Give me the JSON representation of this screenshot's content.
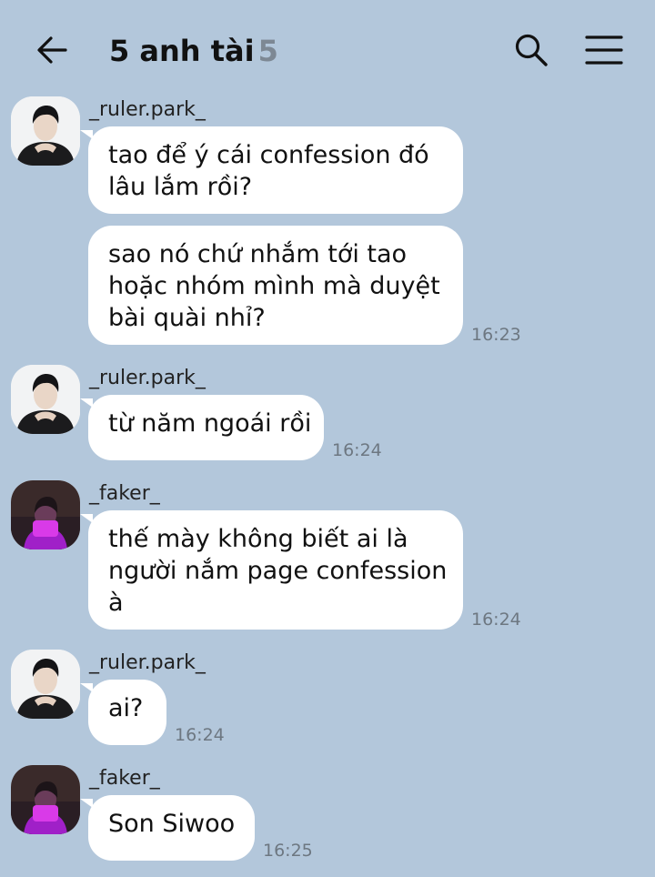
{
  "header": {
    "title": "5 anh tài",
    "member_count": "5",
    "back_icon": "arrow-left-icon",
    "search_icon": "search-icon",
    "menu_icon": "hamburger-menu-icon"
  },
  "messages": [
    {
      "sender": "_ruler.park_",
      "avatar": "avatar-ruler",
      "lines": [
        "tao để ý cái confession đó",
        "lâu lắm rồi?"
      ],
      "time": ""
    },
    {
      "sender": "",
      "avatar": "",
      "lines": [
        "sao nó chứ nhắm tới tao",
        "hoặc nhóm mình mà duyệt",
        "bài quài nhỉ?"
      ],
      "time": "16:23"
    },
    {
      "sender": "_ruler.park_",
      "avatar": "avatar-ruler",
      "lines": [
        "từ năm ngoái rồi"
      ],
      "time": "16:24"
    },
    {
      "sender": "_faker_",
      "avatar": "avatar-faker",
      "lines": [
        "thế mày không biết ai là",
        "người nắm page confession",
        "à"
      ],
      "time": "16:24"
    },
    {
      "sender": "_ruler.park_",
      "avatar": "avatar-ruler",
      "lines": [
        "ai?"
      ],
      "time": "16:24"
    },
    {
      "sender": "_faker_",
      "avatar": "avatar-faker",
      "lines": [
        "Son Siwoo"
      ],
      "time": "16:25"
    }
  ],
  "colors": {
    "background": "#b3c7db",
    "bubble": "#ffffff",
    "title_count": "#7d8894",
    "timestamp": "#6d7781"
  }
}
